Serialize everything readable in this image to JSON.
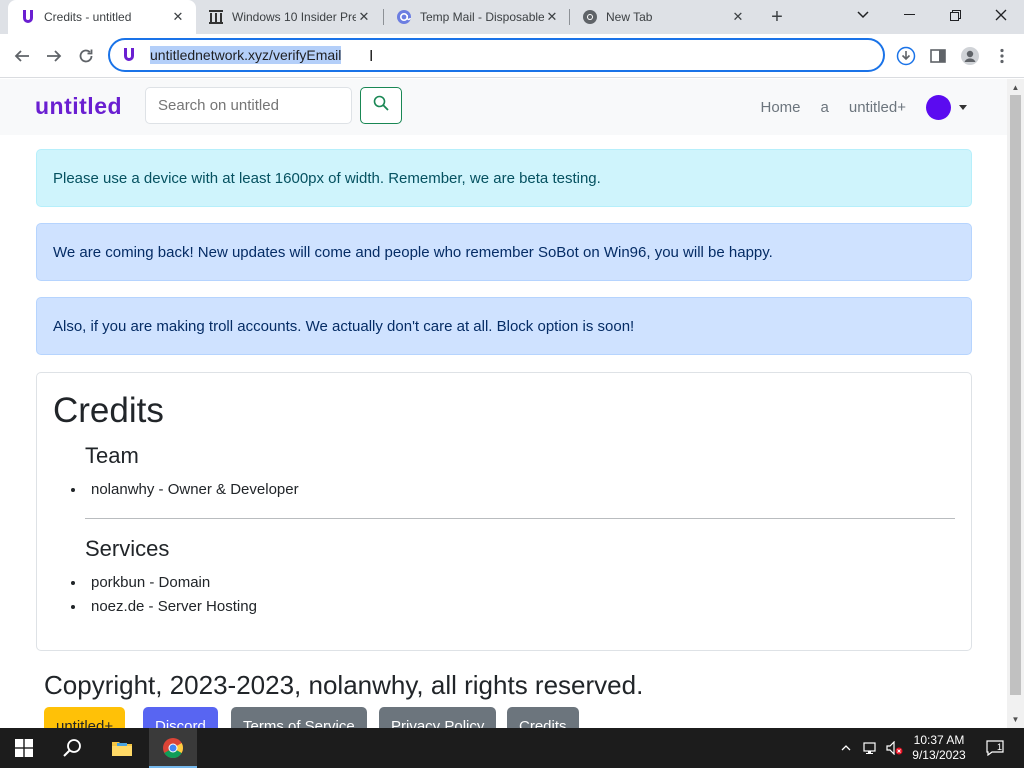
{
  "tabs": [
    {
      "title": "Credits - untitled",
      "icon": "untitled-favicon-icon",
      "active": true
    },
    {
      "title": "Windows 10 Insider Pre",
      "icon": "archive-favicon-icon",
      "active": false
    },
    {
      "title": "Temp Mail - Disposable",
      "icon": "tempmail-favicon-icon",
      "active": false
    },
    {
      "title": "New Tab",
      "icon": "chrome-favicon-icon",
      "active": false
    }
  ],
  "address": {
    "url": "untitlednetwork.xyz/verifyEmail"
  },
  "navbar": {
    "brand": "untitled",
    "search_placeholder": "Search on untitled",
    "links": [
      "Home",
      "a",
      "untitled+"
    ]
  },
  "alerts": [
    "Please use a device with at least 1600px of width. Remember, we are beta testing.",
    "We are coming back! New updates will come and people who remember SoBot on Win96, you will be happy.",
    "Also, if you are making troll accounts. We actually don't care at all. Block option is soon!"
  ],
  "credits": {
    "title": "Credits",
    "team_heading": "Team",
    "team": [
      "nolanwhy - Owner & Developer"
    ],
    "services_heading": "Services",
    "services": [
      "porkbun - Domain",
      "noez.de - Server Hosting"
    ]
  },
  "footer": {
    "copyright": "Copyright, 2023-2023, nolanwhy, all rights reserved.",
    "buttons": [
      {
        "label": "untitled+",
        "color": "#ffc107"
      },
      {
        "label": "Discord",
        "color": "#5865f2"
      },
      {
        "label": "Terms of Service",
        "color": "#6c757d"
      },
      {
        "label": "Privacy Policy",
        "color": "#6c757d"
      },
      {
        "label": "Credits",
        "color": "#6c757d"
      }
    ]
  },
  "taskbar": {
    "time": "10:37 AM",
    "date": "9/13/2023",
    "notification_count": "1"
  },
  "colors": {
    "brand": "#6a1fd1",
    "avatar": "#5b0bf0",
    "search_border": "#198754",
    "focus_ring": "#1a73e8"
  }
}
